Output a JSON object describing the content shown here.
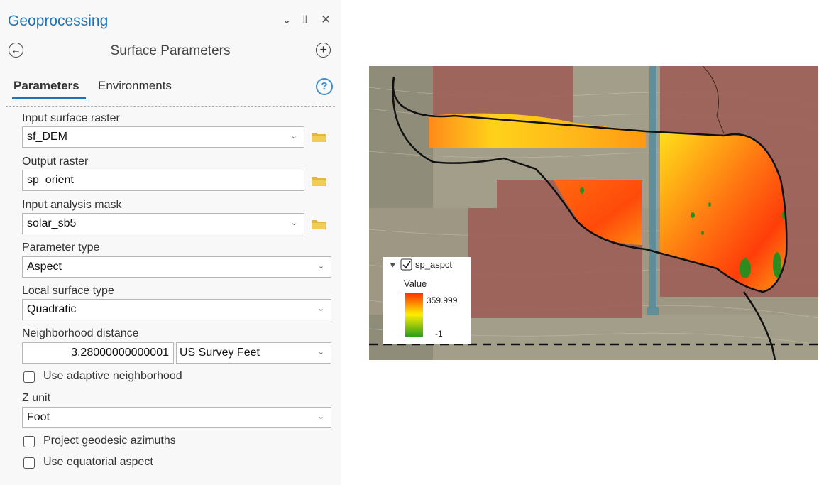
{
  "panel": {
    "title": "Geoprocessing",
    "window_controls": {
      "dropdown": "⌄",
      "pin": "⫫",
      "close": "✕"
    },
    "tool_title": "Surface Parameters",
    "back_glyph": "←",
    "add_glyph": "+",
    "tabs": [
      {
        "label": "Parameters",
        "active": true
      },
      {
        "label": "Environments",
        "active": false
      }
    ],
    "help_glyph": "?"
  },
  "params": {
    "input_surface": {
      "label": "Input surface raster",
      "value": "sf_DEM"
    },
    "output_raster": {
      "label": "Output raster",
      "value": "sp_orient"
    },
    "analysis_mask": {
      "label": "Input analysis mask",
      "value": "solar_sb5"
    },
    "parameter_type": {
      "label": "Parameter type",
      "value": "Aspect"
    },
    "local_surface": {
      "label": "Local surface type",
      "value": "Quadratic"
    },
    "neighborhood": {
      "label": "Neighborhood distance",
      "value": "3.28000000000001",
      "unit": "US Survey Feet"
    },
    "adaptive": {
      "label": "Use adaptive neighborhood",
      "checked": false
    },
    "z_unit": {
      "label": "Z unit",
      "value": "Foot"
    },
    "geodesic": {
      "label": "Project geodesic azimuths",
      "checked": false
    },
    "equatorial": {
      "label": "Use equatorial aspect",
      "checked": false
    }
  },
  "legend": {
    "layer_name": "sp_aspct",
    "checked": true,
    "heading": "Value",
    "max_label": "359.999",
    "min_label": "-1",
    "colors": {
      "high": "#ff2d00",
      "mid": "#ffee00",
      "low": "#2a9e1a"
    }
  },
  "colors": {
    "accent": "#1f73b5",
    "mask_fill": "#9c5a53"
  }
}
